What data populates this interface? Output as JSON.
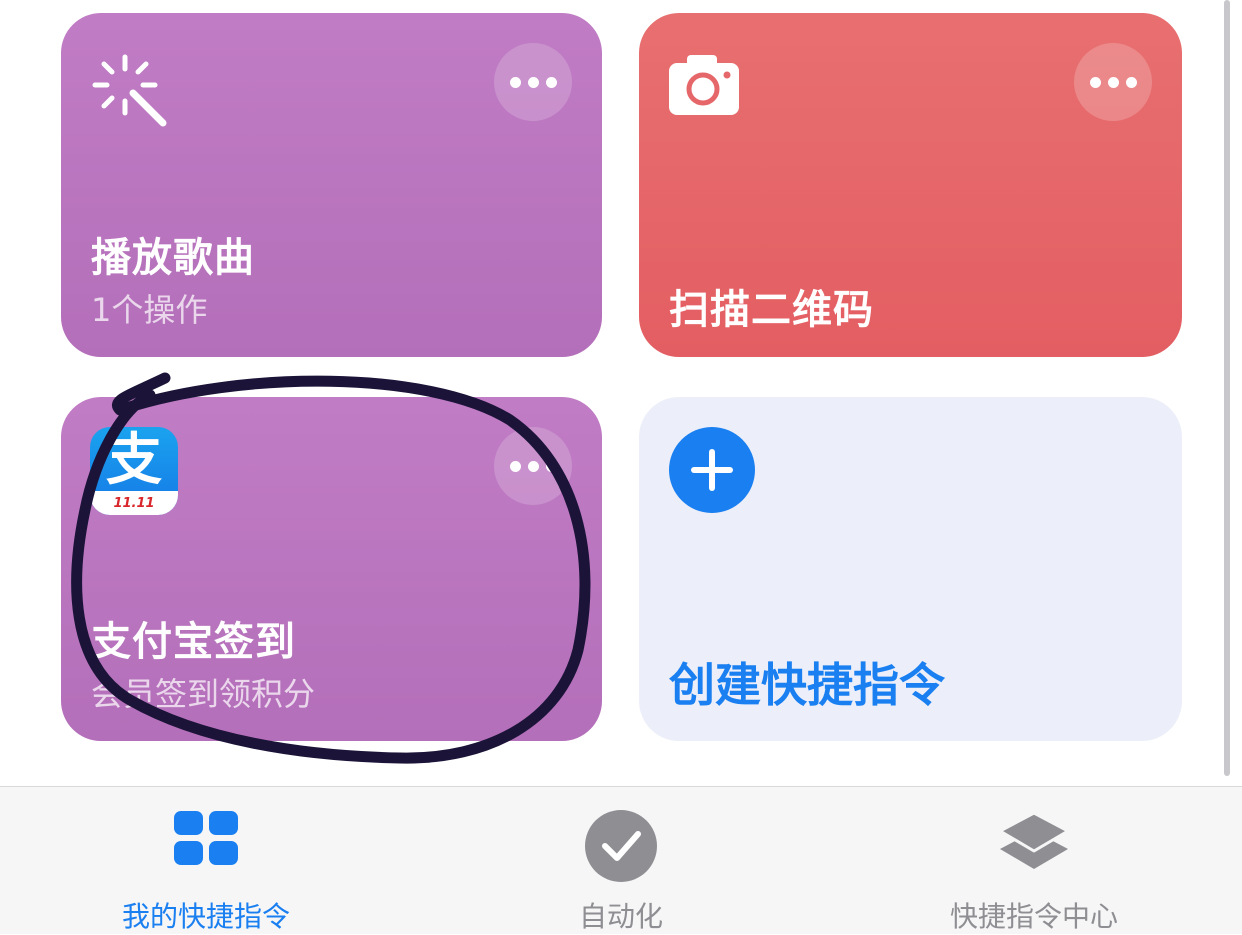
{
  "colors": {
    "purple_card": "#b975bf",
    "red_card": "#e5676a",
    "create_card": "#eceff9",
    "accent_blue": "#1a7ff0",
    "tab_inactive": "#8e8e93",
    "annotation_ink": "#1c1438"
  },
  "shortcuts": [
    {
      "title": "播放歌曲",
      "subtitle": "1个操作",
      "icon": "magic-wand-icon"
    },
    {
      "title": "扫描二维码",
      "icon": "camera-icon"
    },
    {
      "title": "支付宝签到",
      "subtitle": "会员签到领积分",
      "icon": "alipay-icon",
      "icon_text": "支",
      "icon_badge": "11.11"
    }
  ],
  "create_card": {
    "title": "创建快捷指令",
    "icon": "plus-icon"
  },
  "tabbar": {
    "tabs": [
      {
        "label": "我的快捷指令",
        "icon": "grid-icon",
        "active": true
      },
      {
        "label": "自动化",
        "icon": "checkmark-clock-icon",
        "active": false
      },
      {
        "label": "快捷指令中心",
        "icon": "layers-icon",
        "active": false
      }
    ]
  },
  "annotation": {
    "type": "hand-drawn-circle",
    "target": "支付宝签到"
  }
}
